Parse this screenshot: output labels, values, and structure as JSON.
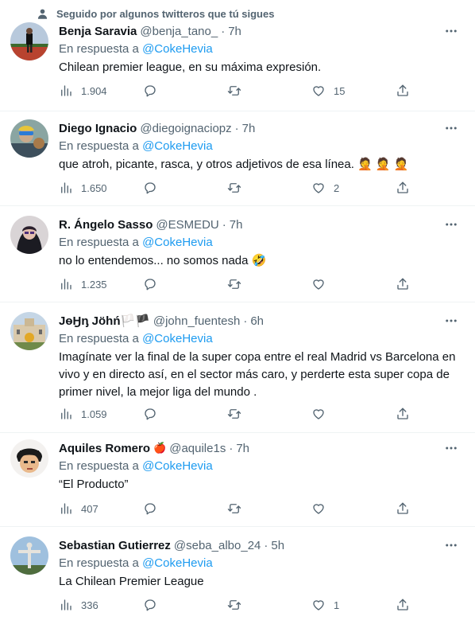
{
  "social_context": {
    "text": "Seguido por algunos twitteros que tú sigues"
  },
  "colors": {
    "link": "#1d9bf0",
    "secondary": "#536471",
    "divider": "#eff3f4"
  },
  "tweets": [
    {
      "name": "Benja Saravia",
      "name_emoji": "",
      "handle": "@benja_tano_",
      "time": "7h",
      "reply_prefix": "En respuesta a",
      "reply_to": "@CokeHevia",
      "text": "Chilean premier league, en su máxima expresión.",
      "views": "1.904",
      "replies": "",
      "retweets": "",
      "likes": "15"
    },
    {
      "name": "Diego Ignacio",
      "name_emoji": "",
      "handle": "@diegoignaciopz",
      "time": "7h",
      "reply_prefix": "En respuesta a",
      "reply_to": "@CokeHevia",
      "text": "que atroh, picante, rasca, y otros adjetivos de esa línea. 🤦 🤦 🤦",
      "views": "1.650",
      "replies": "",
      "retweets": "",
      "likes": "2"
    },
    {
      "name": "R. Ángelo Sasso",
      "name_emoji": "",
      "handle": "@ESMEDU",
      "time": "7h",
      "reply_prefix": "En respuesta a",
      "reply_to": "@CokeHevia",
      "text": "no lo entendemos... no somos nada 🤣",
      "views": "1.235",
      "replies": "",
      "retweets": "",
      "likes": ""
    },
    {
      "name": "JѳӇᶇ Jöhń🏳️🏴",
      "name_emoji": "",
      "handle": "@john_fuentesh",
      "time": "6h",
      "reply_prefix": "En respuesta a",
      "reply_to": "@CokeHevia",
      "text": "Imagínate ver la final de la super copa entre el real Madrid vs Barcelona  en vivo y en directo así, en el sector más caro, y perderte esta super copa  de primer nivel, la mejor liga del mundo .",
      "views": "1.059",
      "replies": "",
      "retweets": "",
      "likes": ""
    },
    {
      "name": "Aquiles Romero",
      "name_emoji": "🍎",
      "handle": "@aquile1s",
      "time": "7h",
      "reply_prefix": "En respuesta a",
      "reply_to": "@CokeHevia",
      "text": "“El Producto”",
      "views": "407",
      "replies": "",
      "retweets": "",
      "likes": ""
    },
    {
      "name": "Sebastian Gutierrez",
      "name_emoji": "",
      "handle": "@seba_albo_24",
      "time": "5h",
      "reply_prefix": "En respuesta a",
      "reply_to": "@CokeHevia",
      "text": "La Chilean Premier League",
      "views": "336",
      "replies": "",
      "retweets": "",
      "likes": "1"
    }
  ]
}
